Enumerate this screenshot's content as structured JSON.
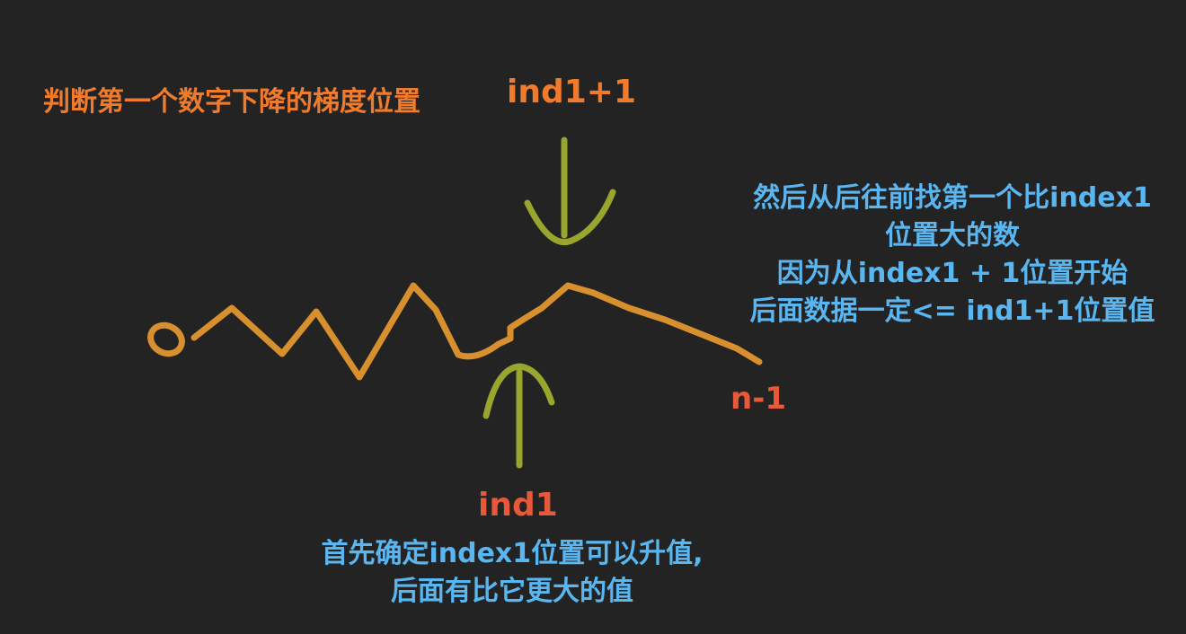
{
  "labels": {
    "top_title": "判断第一个数字下降的梯度位置",
    "top_marker": "ind1+1",
    "end_label": "n-1",
    "bottom_marker": "ind1",
    "right_note": [
      "然后从后往前找第一个比index1",
      "位置大的数",
      "因为从index1 + 1位置开始",
      "后面数据一定<= ind1+1位置值"
    ],
    "bottom_note": [
      "首先确定index1位置可以升值,",
      "后面有比它更大的值"
    ]
  },
  "colors": {
    "background": "#232323",
    "curve": "#d8902e",
    "arrows": "#9aa52e",
    "orange_text": "#f07b2c",
    "red_text": "#e8583a",
    "blue_text": "#5ab6f0"
  }
}
